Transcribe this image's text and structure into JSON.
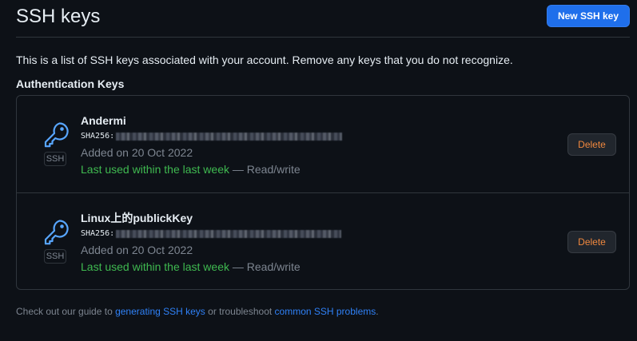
{
  "header": {
    "title": "SSH keys",
    "new_key_label": "New SSH key"
  },
  "intro_text": "This is a list of SSH keys associated with your account. Remove any keys that you do not recognize.",
  "section_title": "Authentication Keys",
  "keys": [
    {
      "name": "Andermi",
      "fingerprint_label": "SHA256:",
      "added_on": "Added on 20 Oct 2022",
      "last_used": "Last used within the last week",
      "access": " — Read/write",
      "badge": "SSH",
      "delete_label": "Delete",
      "icon": "key-icon"
    },
    {
      "name": "Linux上的publickKey",
      "fingerprint_label": "SHA256:",
      "added_on": "Added on 20 Oct 2022",
      "last_used": "Last used within the last week",
      "access": " — Read/write",
      "badge": "SSH",
      "delete_label": "Delete",
      "icon": "key-icon"
    }
  ],
  "footer": {
    "prefix": "Check out our guide to ",
    "link1": "generating SSH keys",
    "middle": " or troubleshoot ",
    "link2": "common SSH problems",
    "suffix": "."
  },
  "colors": {
    "background": "#0d1117",
    "primary_button": "#1f6feb",
    "icon_blue": "#58a6ff",
    "last_used_green": "#3fb950",
    "delete_orange": "#f0883e",
    "link_blue": "#2f81f7"
  }
}
